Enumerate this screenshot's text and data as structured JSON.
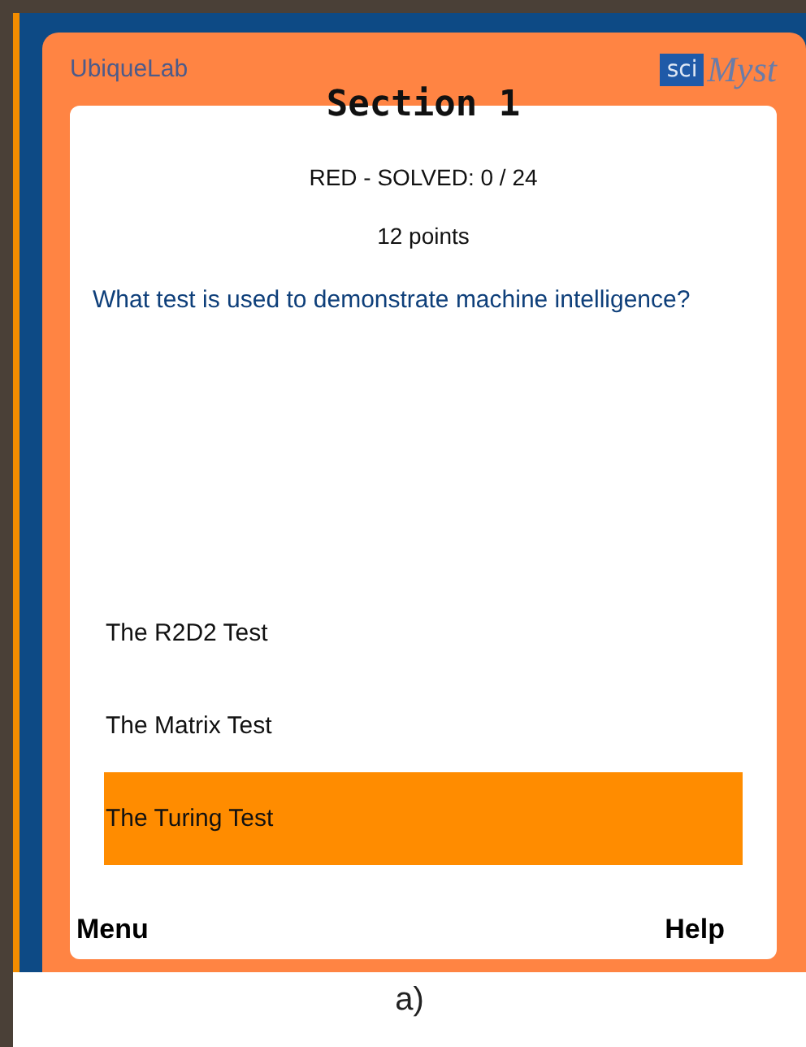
{
  "header": {
    "brand_left": "UbiqueLab",
    "brand_right_badge": "sci",
    "brand_right_word": "Myst",
    "title": "Section 1"
  },
  "status": "RED - SOLVED: 0 / 24",
  "points": "12 points",
  "question": "What test is used to demonstrate machine intelligence?",
  "answers": [
    {
      "label": "The R2D2 Test",
      "selected": false
    },
    {
      "label": "The Matrix Test",
      "selected": false
    },
    {
      "label": "The Turing Test",
      "selected": true
    }
  ],
  "softkeys": [
    "Menu",
    "Help"
  ],
  "caption": "a)"
}
